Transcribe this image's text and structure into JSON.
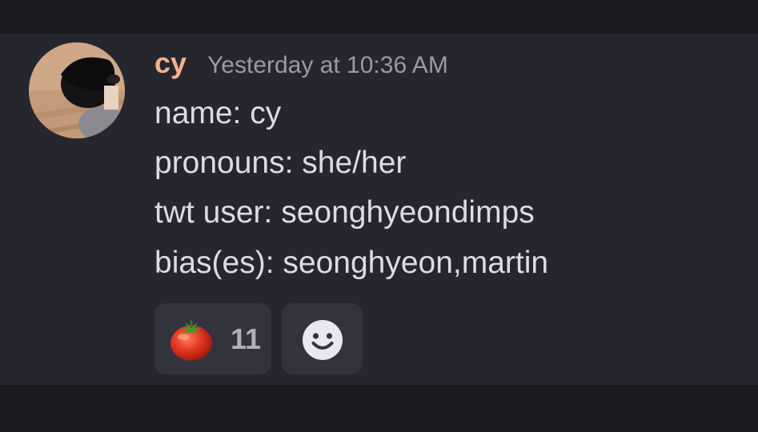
{
  "message": {
    "username": "cy",
    "timestamp": "Yesterday at 10:36 AM",
    "lines": [
      "name: cy",
      "pronouns: she/her",
      "twt user: seonghyeondimps",
      "bias(es): seonghyeon,martin"
    ]
  },
  "reactions": [
    {
      "icon": "tomato-emoji-icon",
      "count": "11"
    }
  ],
  "add_reaction": {
    "icon": "smile-face-icon"
  },
  "colors": {
    "username": "#f6b08c",
    "timestamp": "#9a9aa6",
    "text": "#dcdce2",
    "message_bg": "#26262f",
    "outer_bg": "#1a1a1e",
    "reaction_bg": "#33333d"
  }
}
